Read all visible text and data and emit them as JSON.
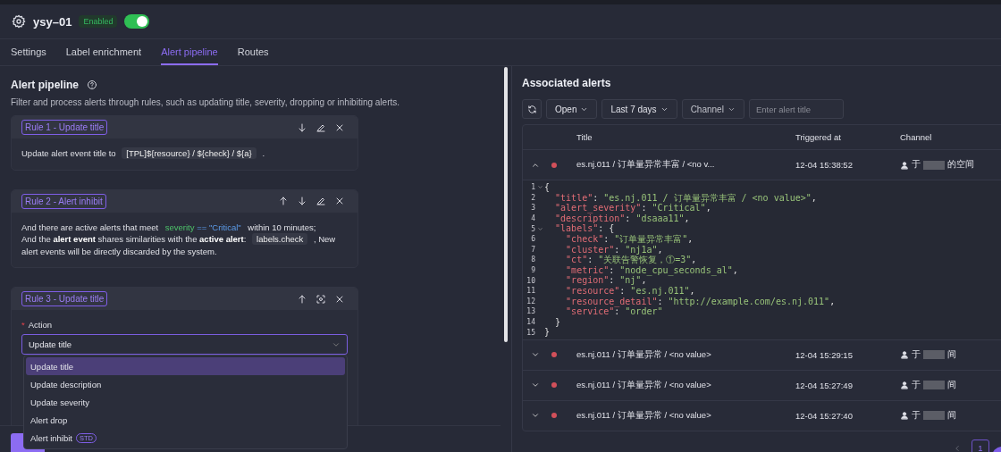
{
  "header": {
    "title": "ysy–01",
    "status_badge": "Enabled",
    "enabled": true
  },
  "tabs": [
    {
      "label": "Settings",
      "selected": false
    },
    {
      "label": "Label enrichment",
      "selected": false
    },
    {
      "label": "Alert pipeline",
      "selected": true
    },
    {
      "label": "Routes",
      "selected": false
    }
  ],
  "pipeline": {
    "title": "Alert pipeline",
    "description": "Filter and process alerts through rules, such as updating title, severity, dropping or inhibiting alerts.",
    "rules": [
      {
        "tag": "Rule 1 - Update title",
        "kind": "text",
        "can_move_up": false,
        "can_move_down": true,
        "editing": false,
        "paragraphs": [
          [
            {
              "kind": "text",
              "text": "Update alert event title to"
            },
            {
              "kind": "code",
              "text": "[TPL]${resource} / ${check} / ${a}"
            },
            {
              "kind": "text",
              "text": "."
            }
          ]
        ]
      },
      {
        "tag": "Rule 2 - Alert inhibit",
        "kind": "text",
        "can_move_up": true,
        "can_move_down": true,
        "editing": false,
        "paragraphs": [
          [
            {
              "kind": "text",
              "text": "And there are active alerts that meet"
            },
            {
              "kind": "condition",
              "field": "severity",
              "op": "==",
              "value": "\"Critical\""
            },
            {
              "kind": "text",
              "text": "within 10 minutes;"
            }
          ],
          [
            {
              "kind": "text",
              "text": "And the **alert event** shares similarities with the **active alert**:"
            },
            {
              "kind": "code",
              "text": "labels.check"
            },
            {
              "kind": "text",
              "text": ", New alert events will be directly discarded by the system."
            }
          ]
        ]
      },
      {
        "tag": "Rule 3 - Update title",
        "kind": "form",
        "can_move_up": true,
        "can_move_down": false,
        "editing": true,
        "field_label": "Action",
        "required_mark": "*",
        "value": "Update title",
        "options": [
          {
            "label": "Update title",
            "selected": true
          },
          {
            "label": "Update description",
            "selected": false
          },
          {
            "label": "Update severity",
            "selected": false
          },
          {
            "label": "Alert drop",
            "selected": false
          },
          {
            "label": "Alert inhibit",
            "selected": false,
            "badge": "STD"
          }
        ]
      }
    ]
  },
  "alerts": {
    "title": "Associated alerts",
    "filters": [
      {
        "label": "Open",
        "muted": false
      },
      {
        "label": "Last 7 days",
        "muted": false
      },
      {
        "label": "Channel",
        "muted": true
      }
    ],
    "search": {
      "placeholder": "Enter alert title"
    },
    "columns": [
      "Title",
      "Triggered at",
      "Channel"
    ],
    "rows": [
      {
        "expanded": true,
        "title": "es.nj.011 / 订单量异常丰富 / <no v...",
        "triggered_at": "12-04 15:38:52",
        "channel_prefix": "于",
        "channel_suffix": "的空间",
        "detail_lines": [
          {
            "number": "1",
            "text": "{",
            "foldable": true
          },
          {
            "number": "2",
            "text": "  \"title\": \"es.nj.011 / 订单量异常丰富 / <no value>\",",
            "foldable": false
          },
          {
            "number": "3",
            "text": "  \"alert_severity\": \"Critical\",",
            "foldable": false
          },
          {
            "number": "4",
            "text": "  \"description\": \"dsaaa11\",",
            "foldable": false
          },
          {
            "number": "5",
            "text": "  \"labels\": {",
            "foldable": true
          },
          {
            "number": "6",
            "text": "    \"check\": \"订单量异常丰富\",",
            "foldable": false
          },
          {
            "number": "7",
            "text": "    \"cluster\": \"nj1a\",",
            "foldable": false
          },
          {
            "number": "8",
            "text": "    \"ct\": \"关联告警恢复，①=3\",",
            "foldable": false
          },
          {
            "number": "9",
            "text": "    \"metric\": \"node_cpu_seconds_al\",",
            "foldable": false
          },
          {
            "number": "10",
            "text": "    \"region\": \"nj\",",
            "foldable": false
          },
          {
            "number": "11",
            "text": "    \"resource\": \"es.nj.011\",",
            "foldable": false
          },
          {
            "number": "12",
            "text": "    \"resource_detail\": \"http://example.com/es.nj.011\",",
            "foldable": false
          },
          {
            "number": "13",
            "text": "    \"service\": \"order\"",
            "foldable": false
          },
          {
            "number": "14",
            "text": "  }",
            "foldable": false
          },
          {
            "number": "15",
            "text": "}",
            "foldable": false
          }
        ]
      },
      {
        "expanded": false,
        "title": "es.nj.011 / 订单量异常 / <no value>",
        "triggered_at": "12-04 15:29:15",
        "channel_prefix": "于",
        "channel_suffix": "间"
      },
      {
        "expanded": false,
        "title": "es.nj.011 / 订单量异常 / <no value>",
        "triggered_at": "12-04 15:27:49",
        "channel_prefix": "于",
        "channel_suffix": "间"
      },
      {
        "expanded": false,
        "title": "es.nj.011 / 订单量异常 / <no value>",
        "triggered_at": "12-04 15:27:40",
        "channel_prefix": "于",
        "channel_suffix": "间"
      }
    ],
    "pagination": [
      {
        "label": "1",
        "selected": true
      }
    ]
  }
}
